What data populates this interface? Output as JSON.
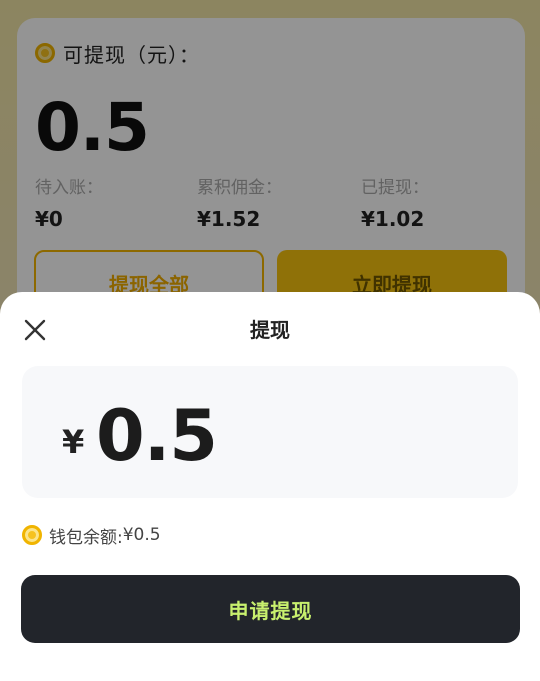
{
  "background_card": {
    "title": "可提现（元）：",
    "amount": "0.5",
    "stats": [
      {
        "label": "待入账：",
        "value": "¥0"
      },
      {
        "label": "累积佣金：",
        "value": "¥1.52"
      },
      {
        "label": "已提现：",
        "value": "¥1.02"
      }
    ],
    "withdraw_all_label": "提现全部",
    "withdraw_now_label": "立即提现"
  },
  "sheet": {
    "title": "提现",
    "currency_symbol": "¥",
    "amount_value": "0.5",
    "balance_label": "钱包余额:",
    "balance_value": "¥0.5",
    "submit_label": "申请提现"
  },
  "colors": {
    "accent": "#f7c30e",
    "submit_bg": "#22252b",
    "submit_text": "#c8f06e"
  },
  "icons": {
    "coin": "coin-icon",
    "close": "close-icon"
  }
}
